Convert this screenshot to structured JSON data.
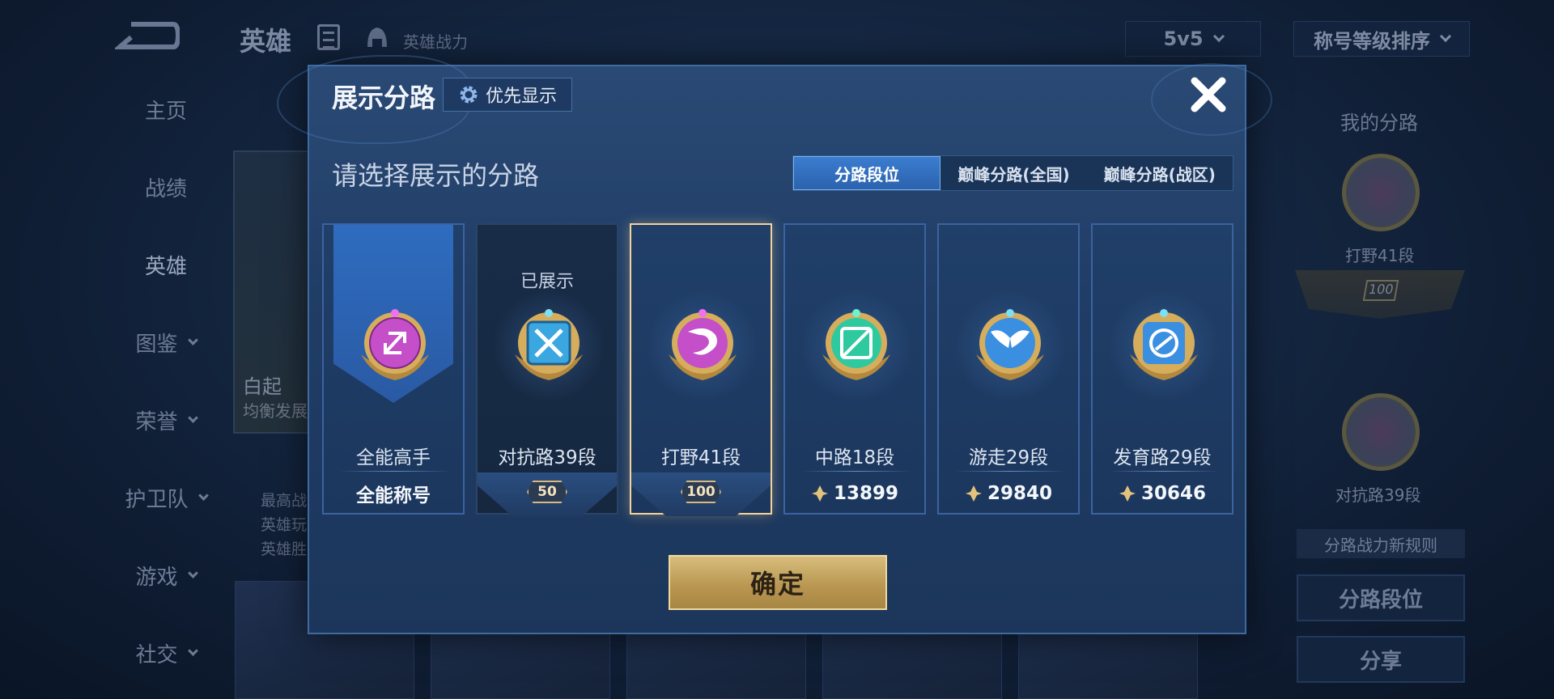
{
  "background": {
    "title": "英雄",
    "hero_power_label": "英雄战力",
    "mode_select": "5v5",
    "sort_select": "称号等级排序",
    "nav": [
      {
        "label": "主页",
        "has_chevron": false
      },
      {
        "label": "战绩",
        "has_chevron": false
      },
      {
        "label": "英雄",
        "has_chevron": false,
        "active": true
      },
      {
        "label": "图鉴",
        "has_chevron": true
      },
      {
        "label": "荣誉",
        "has_chevron": true
      },
      {
        "label": "护卫队",
        "has_chevron": true
      },
      {
        "label": "游戏",
        "has_chevron": true
      },
      {
        "label": "社交",
        "has_chevron": true
      }
    ],
    "hero": {
      "name": "白起",
      "subtitle": "均衡发展",
      "notes": [
        "最高战",
        "英雄玩",
        "英雄胜"
      ]
    },
    "right_panel": {
      "title": "我的分路",
      "badge1_label": "打野41段",
      "badge1_num": "100",
      "badge2_label": "对抗路39段",
      "note": "分路战力新规则",
      "button_rank": "分路段位",
      "button_share": "分享"
    }
  },
  "modal": {
    "title": "展示分路",
    "priority_button": "优先显示",
    "subtitle": "请选择展示的分路",
    "tabs": [
      {
        "label": "分路段位",
        "active": true
      },
      {
        "label": "巅峰分路(全国)",
        "active": false
      },
      {
        "label": "巅峰分路(战区)",
        "active": false
      }
    ],
    "lanes": [
      {
        "name": "全能高手",
        "value": "全能称号",
        "type": "title",
        "badge_color": "#c44fc8",
        "icon": "allround-icon"
      },
      {
        "name": "对抗路39段",
        "shown_tag": "已展示",
        "banner_num": "50",
        "type": "banner",
        "badge_color": "#3aa7e0",
        "icon": "clash-icon"
      },
      {
        "name": "打野41段",
        "banner_num": "100",
        "type": "banner",
        "selected": true,
        "badge_color": "#c44fc8",
        "icon": "jungle-icon"
      },
      {
        "name": "中路18段",
        "value": "13899",
        "type": "points",
        "badge_color": "#2fc9a0",
        "icon": "mid-icon"
      },
      {
        "name": "游走29段",
        "value": "29840",
        "type": "points",
        "badge_color": "#3a8fe0",
        "icon": "roam-icon"
      },
      {
        "name": "发育路29段",
        "value": "30646",
        "type": "points",
        "badge_color": "#3a8fe0",
        "icon": "farm-icon"
      }
    ],
    "confirm_button": "确定"
  }
}
